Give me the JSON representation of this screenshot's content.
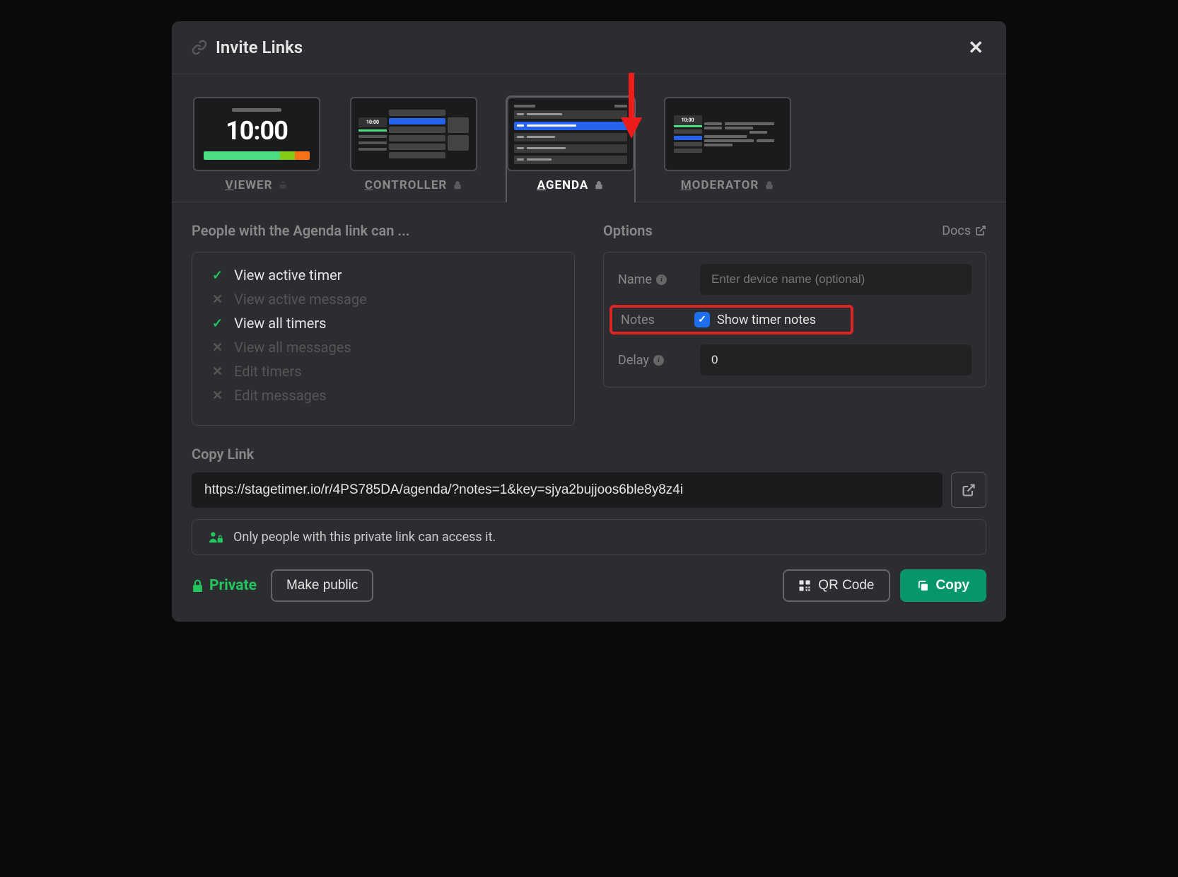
{
  "modal": {
    "title": "Invite Links"
  },
  "tabs": {
    "viewer": {
      "label": "VIEWER",
      "preview_time": "10:00"
    },
    "controller": {
      "label": "CONTROLLER",
      "preview_time": "10:00"
    },
    "agenda": {
      "label": "AGENDA"
    },
    "moderator": {
      "label": "MODERATOR",
      "preview_time": "10:00"
    }
  },
  "permissions": {
    "heading": "People with the Agenda link can ...",
    "items": [
      {
        "label": "View active timer",
        "enabled": true
      },
      {
        "label": "View active message",
        "enabled": false
      },
      {
        "label": "View all timers",
        "enabled": true
      },
      {
        "label": "View all messages",
        "enabled": false
      },
      {
        "label": "Edit timers",
        "enabled": false
      },
      {
        "label": "Edit messages",
        "enabled": false
      }
    ]
  },
  "options": {
    "heading": "Options",
    "docs_label": "Docs",
    "name": {
      "label": "Name",
      "placeholder": "Enter device name (optional)",
      "value": ""
    },
    "notes": {
      "label": "Notes",
      "checkbox_label": "Show timer notes",
      "checked": true
    },
    "delay": {
      "label": "Delay",
      "value": "0"
    }
  },
  "copy_link": {
    "heading": "Copy Link",
    "url": "https://stagetimer.io/r/4PS785DA/agenda/?notes=1&key=sjya2bujjoos6ble8y8z4i"
  },
  "notice": {
    "text": "Only people with this private link can access it."
  },
  "footer": {
    "privacy_label": "Private",
    "make_public_label": "Make public",
    "qr_label": "QR Code",
    "copy_label": "Copy"
  }
}
